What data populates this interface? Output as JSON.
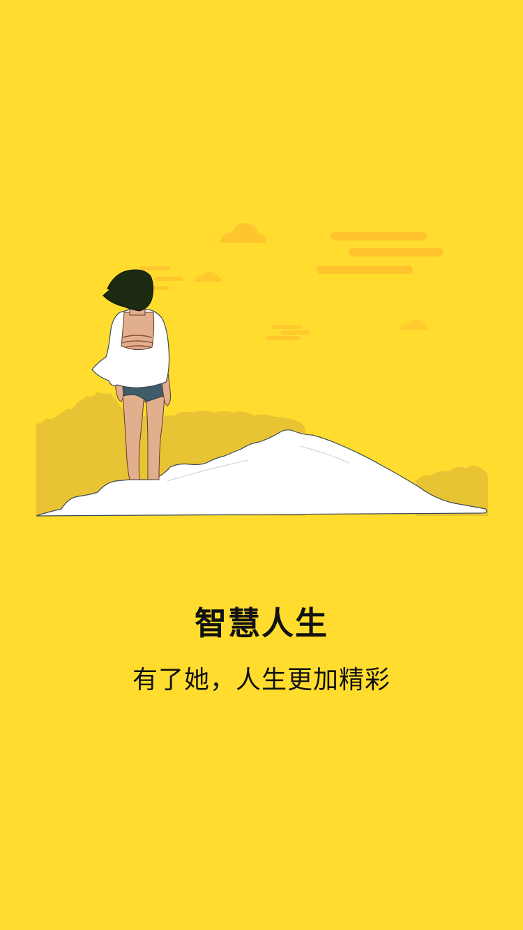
{
  "onboarding": {
    "title": "智慧人生",
    "subtitle": "有了她，人生更加精彩"
  },
  "illustration": {
    "description_icon": "girl-on-hill-illustration"
  },
  "colors": {
    "background": "#FFDC2E",
    "cloud": "#FFC12E",
    "bush": "#E8C434",
    "hill": "#FFFFFF",
    "hair": "#1C2A12",
    "skin": "#E2AF8E",
    "shorts": "#3E5C6A",
    "text": "#111111"
  }
}
